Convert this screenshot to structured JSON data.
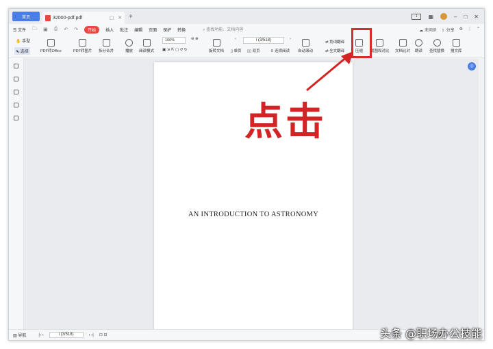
{
  "titlebar": {
    "home_tab": "首页",
    "doc_tab": "32000-pdf.pdf",
    "new_tab": "+"
  },
  "menu": {
    "file": "文件",
    "items": [
      "开始",
      "插入",
      "批注",
      "编辑",
      "页面",
      "保护",
      "转换"
    ],
    "search": "查找功能、文档内容",
    "sync": "未同步",
    "share": "分享"
  },
  "toolbar": {
    "hand": "手型",
    "select": "选择",
    "pdf_to_office": "PDF转Office",
    "pdf_to_image": "PDF转图片",
    "split_merge": "拆分合并",
    "play": "播放",
    "read_mode": "阅读模式",
    "zoom": "100%",
    "rotate": "旋转文档",
    "single_page": "单页",
    "double_page": "双页",
    "continuous": "连续阅读",
    "auto_scroll": "自动滚动",
    "page_indicator": "i (3/518)",
    "word_translate": "划词翻译",
    "full_translate": "全文翻译",
    "compress": "压缩",
    "screenshot_compare": "截图和对比",
    "text_compare": "文档比对",
    "read_aloud": "朗读",
    "find_replace": "查找替换",
    "search_library": "搜文库"
  },
  "document": {
    "title": "AN INTRODUCTION TO ASTRONOMY"
  },
  "statusbar": {
    "nav": "导航",
    "page": "i (3/518)"
  },
  "annotation": {
    "text": "点击",
    "color": "#d22424"
  },
  "watermark": "头条 @职场办公技能"
}
